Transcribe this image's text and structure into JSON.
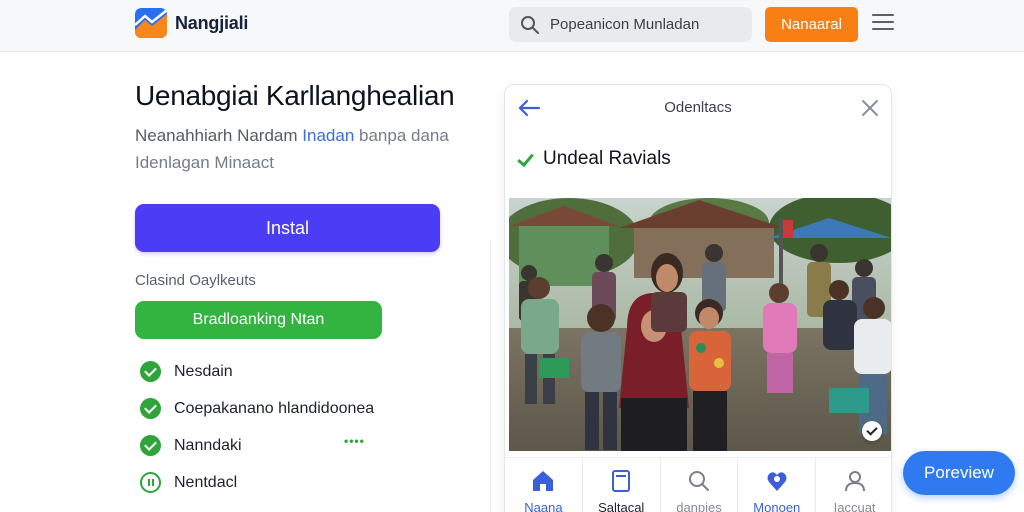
{
  "header": {
    "brand_name": "Nangjiali",
    "search_placeholder": "Popeanicon Munladan",
    "cta_label": "Nanaaral"
  },
  "hero": {
    "title": "Uenabgiai Karllanghealian",
    "subtitle_line1_a": "Neanahhiarh Nardam",
    "subtitle_line1_accent": "Inadan",
    "subtitle_line1_b": "banpa dana",
    "subtitle_line2": "Idenlagan Minaact",
    "install_label": "Instal"
  },
  "options": {
    "section_label": "Clasind Oaylkeuts",
    "green_button_label": "Bradloanking Ntan",
    "items": [
      {
        "label": "Nesdain",
        "state": "done"
      },
      {
        "label": "Coepakanano hlandidoonea",
        "state": "done"
      },
      {
        "label": "Nanndaki",
        "state": "done"
      },
      {
        "label": "Nentdacl",
        "state": "pending"
      }
    ],
    "dots": "••••"
  },
  "card": {
    "title": "Odenltacs",
    "status": "Undeal Ravials",
    "tabs": [
      {
        "label": "Naana",
        "icon": "home-icon",
        "state": "active"
      },
      {
        "label": "Saltacal",
        "icon": "document-icon",
        "state": "dark"
      },
      {
        "label": "danpies",
        "icon": "search-icon",
        "state": "normal"
      },
      {
        "label": "Monoen",
        "icon": "heart-location-icon",
        "state": "active"
      },
      {
        "label": "Iaccuat",
        "icon": "user-icon",
        "state": "normal"
      }
    ]
  },
  "floating": {
    "preview_label": "Poreview"
  },
  "colors": {
    "accent_blue": "#4b3cf6",
    "green": "#33b33f",
    "orange": "#f77f14",
    "preview_blue": "#2f7af0"
  }
}
